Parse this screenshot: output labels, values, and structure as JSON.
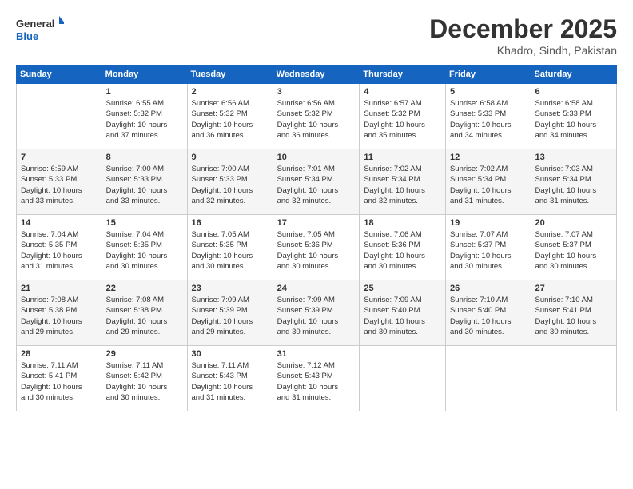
{
  "logo": {
    "general": "General",
    "blue": "Blue"
  },
  "header": {
    "month": "December 2025",
    "location": "Khadro, Sindh, Pakistan"
  },
  "days_of_week": [
    "Sunday",
    "Monday",
    "Tuesday",
    "Wednesday",
    "Thursday",
    "Friday",
    "Saturday"
  ],
  "weeks": [
    [
      {
        "day": "",
        "info": ""
      },
      {
        "day": "1",
        "info": "Sunrise: 6:55 AM\nSunset: 5:32 PM\nDaylight: 10 hours\nand 37 minutes."
      },
      {
        "day": "2",
        "info": "Sunrise: 6:56 AM\nSunset: 5:32 PM\nDaylight: 10 hours\nand 36 minutes."
      },
      {
        "day": "3",
        "info": "Sunrise: 6:56 AM\nSunset: 5:32 PM\nDaylight: 10 hours\nand 36 minutes."
      },
      {
        "day": "4",
        "info": "Sunrise: 6:57 AM\nSunset: 5:32 PM\nDaylight: 10 hours\nand 35 minutes."
      },
      {
        "day": "5",
        "info": "Sunrise: 6:58 AM\nSunset: 5:33 PM\nDaylight: 10 hours\nand 34 minutes."
      },
      {
        "day": "6",
        "info": "Sunrise: 6:58 AM\nSunset: 5:33 PM\nDaylight: 10 hours\nand 34 minutes."
      }
    ],
    [
      {
        "day": "7",
        "info": "Sunrise: 6:59 AM\nSunset: 5:33 PM\nDaylight: 10 hours\nand 33 minutes."
      },
      {
        "day": "8",
        "info": "Sunrise: 7:00 AM\nSunset: 5:33 PM\nDaylight: 10 hours\nand 33 minutes."
      },
      {
        "day": "9",
        "info": "Sunrise: 7:00 AM\nSunset: 5:33 PM\nDaylight: 10 hours\nand 32 minutes."
      },
      {
        "day": "10",
        "info": "Sunrise: 7:01 AM\nSunset: 5:34 PM\nDaylight: 10 hours\nand 32 minutes."
      },
      {
        "day": "11",
        "info": "Sunrise: 7:02 AM\nSunset: 5:34 PM\nDaylight: 10 hours\nand 32 minutes."
      },
      {
        "day": "12",
        "info": "Sunrise: 7:02 AM\nSunset: 5:34 PM\nDaylight: 10 hours\nand 31 minutes."
      },
      {
        "day": "13",
        "info": "Sunrise: 7:03 AM\nSunset: 5:34 PM\nDaylight: 10 hours\nand 31 minutes."
      }
    ],
    [
      {
        "day": "14",
        "info": "Sunrise: 7:04 AM\nSunset: 5:35 PM\nDaylight: 10 hours\nand 31 minutes."
      },
      {
        "day": "15",
        "info": "Sunrise: 7:04 AM\nSunset: 5:35 PM\nDaylight: 10 hours\nand 30 minutes."
      },
      {
        "day": "16",
        "info": "Sunrise: 7:05 AM\nSunset: 5:35 PM\nDaylight: 10 hours\nand 30 minutes."
      },
      {
        "day": "17",
        "info": "Sunrise: 7:05 AM\nSunset: 5:36 PM\nDaylight: 10 hours\nand 30 minutes."
      },
      {
        "day": "18",
        "info": "Sunrise: 7:06 AM\nSunset: 5:36 PM\nDaylight: 10 hours\nand 30 minutes."
      },
      {
        "day": "19",
        "info": "Sunrise: 7:07 AM\nSunset: 5:37 PM\nDaylight: 10 hours\nand 30 minutes."
      },
      {
        "day": "20",
        "info": "Sunrise: 7:07 AM\nSunset: 5:37 PM\nDaylight: 10 hours\nand 30 minutes."
      }
    ],
    [
      {
        "day": "21",
        "info": "Sunrise: 7:08 AM\nSunset: 5:38 PM\nDaylight: 10 hours\nand 29 minutes."
      },
      {
        "day": "22",
        "info": "Sunrise: 7:08 AM\nSunset: 5:38 PM\nDaylight: 10 hours\nand 29 minutes."
      },
      {
        "day": "23",
        "info": "Sunrise: 7:09 AM\nSunset: 5:39 PM\nDaylight: 10 hours\nand 29 minutes."
      },
      {
        "day": "24",
        "info": "Sunrise: 7:09 AM\nSunset: 5:39 PM\nDaylight: 10 hours\nand 30 minutes."
      },
      {
        "day": "25",
        "info": "Sunrise: 7:09 AM\nSunset: 5:40 PM\nDaylight: 10 hours\nand 30 minutes."
      },
      {
        "day": "26",
        "info": "Sunrise: 7:10 AM\nSunset: 5:40 PM\nDaylight: 10 hours\nand 30 minutes."
      },
      {
        "day": "27",
        "info": "Sunrise: 7:10 AM\nSunset: 5:41 PM\nDaylight: 10 hours\nand 30 minutes."
      }
    ],
    [
      {
        "day": "28",
        "info": "Sunrise: 7:11 AM\nSunset: 5:41 PM\nDaylight: 10 hours\nand 30 minutes."
      },
      {
        "day": "29",
        "info": "Sunrise: 7:11 AM\nSunset: 5:42 PM\nDaylight: 10 hours\nand 30 minutes."
      },
      {
        "day": "30",
        "info": "Sunrise: 7:11 AM\nSunset: 5:43 PM\nDaylight: 10 hours\nand 31 minutes."
      },
      {
        "day": "31",
        "info": "Sunrise: 7:12 AM\nSunset: 5:43 PM\nDaylight: 10 hours\nand 31 minutes."
      },
      {
        "day": "",
        "info": ""
      },
      {
        "day": "",
        "info": ""
      },
      {
        "day": "",
        "info": ""
      }
    ]
  ]
}
